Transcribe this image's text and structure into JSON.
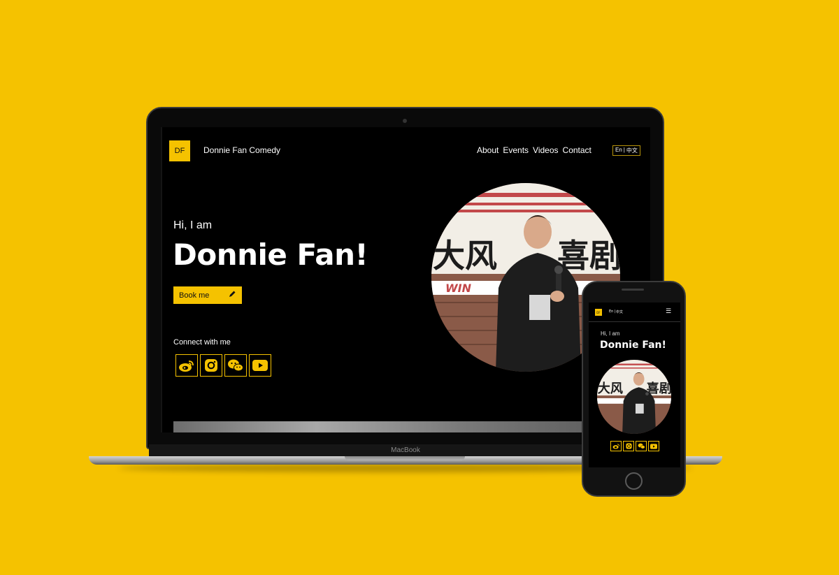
{
  "laptop": {
    "chin_label": "MacBook",
    "site": {
      "logo_text": "DF",
      "brand": "Donnie Fan Comedy",
      "nav": [
        "About",
        "Events",
        "Videos",
        "Contact"
      ],
      "lang": {
        "en": "En",
        "sep": "|",
        "zh": "中文"
      },
      "greeting": "Hi, I am",
      "name": "Donnie Fan!",
      "book_label": "Book me",
      "connect_label": "Connect with me",
      "socials": [
        "weibo-icon",
        "instagram-icon",
        "wechat-icon",
        "youtube-icon"
      ]
    }
  },
  "phone": {
    "site": {
      "logo_text": "DF",
      "lang": {
        "en": "En",
        "sep": "|",
        "zh": "中文"
      },
      "menu_glyph": "☰",
      "greeting": "Hi, I am",
      "name": "Donnie Fan!"
    }
  },
  "colors": {
    "accent": "#f5c200",
    "background": "#000000"
  }
}
